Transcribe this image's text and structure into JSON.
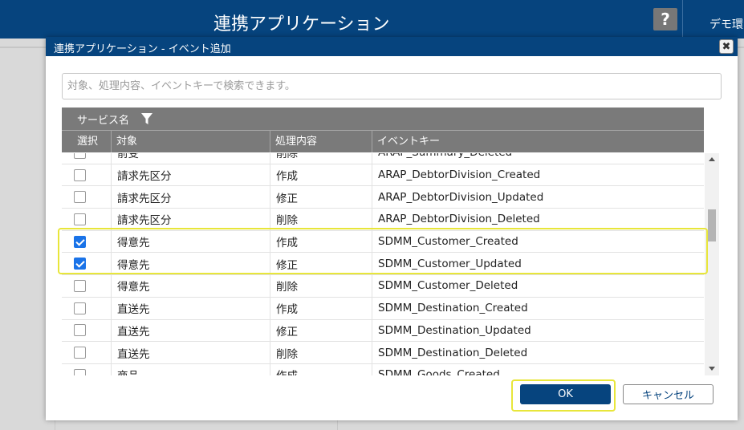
{
  "app": {
    "title": "連携アプリケーション",
    "help_label": "?",
    "env_label": "デモ環"
  },
  "dialog": {
    "title": "連携アプリケーション - イベント追加",
    "close_label": "✖",
    "search_placeholder": "対象、処理内容、イベントキーで検索できます。",
    "service_header": "サービス名",
    "columns": [
      "選択",
      "対象",
      "処理内容",
      "イベントキー"
    ],
    "rows": [
      {
        "checked": false,
        "target": "前受",
        "action": "削除",
        "key": "ARAP_Summary_Deleted"
      },
      {
        "checked": false,
        "target": "請求先区分",
        "action": "作成",
        "key": "ARAP_DebtorDivision_Created"
      },
      {
        "checked": false,
        "target": "請求先区分",
        "action": "修正",
        "key": "ARAP_DebtorDivision_Updated"
      },
      {
        "checked": false,
        "target": "請求先区分",
        "action": "削除",
        "key": "ARAP_DebtorDivision_Deleted"
      },
      {
        "checked": true,
        "target": "得意先",
        "action": "作成",
        "key": "SDMM_Customer_Created"
      },
      {
        "checked": true,
        "target": "得意先",
        "action": "修正",
        "key": "SDMM_Customer_Updated"
      },
      {
        "checked": false,
        "target": "得意先",
        "action": "削除",
        "key": "SDMM_Customer_Deleted"
      },
      {
        "checked": false,
        "target": "直送先",
        "action": "作成",
        "key": "SDMM_Destination_Created"
      },
      {
        "checked": false,
        "target": "直送先",
        "action": "修正",
        "key": "SDMM_Destination_Updated"
      },
      {
        "checked": false,
        "target": "直送先",
        "action": "削除",
        "key": "SDMM_Destination_Deleted"
      },
      {
        "checked": false,
        "target": "商品",
        "action": "作成",
        "key": "SDMM_Goods_Created"
      }
    ],
    "ok_label": "OK",
    "cancel_label": "キャンセル"
  },
  "colors": {
    "header_bg": "#06447e",
    "grid_header_bg": "#7a7a7a",
    "checkbox_checked": "#1a73e8",
    "highlight": "#e8e63a"
  }
}
